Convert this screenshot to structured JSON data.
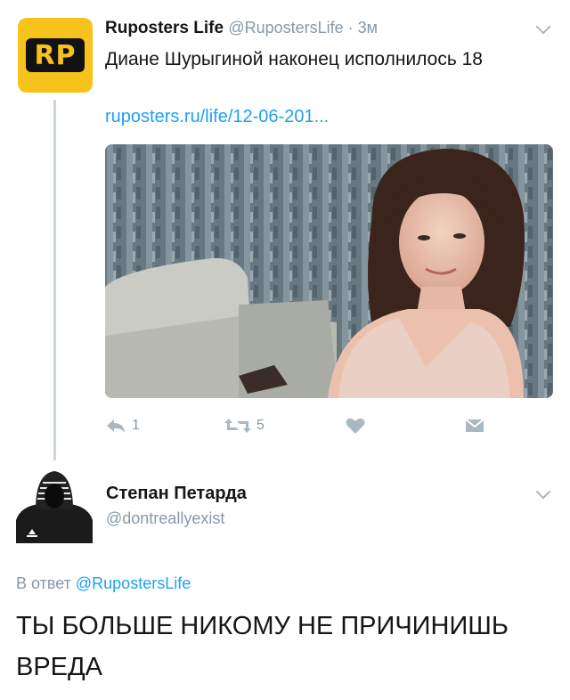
{
  "tweet1": {
    "author_name": "Ruposters Life",
    "author_handle": "@RupostersLife",
    "separator": " · ",
    "time": "3м",
    "avatar_text": "RP",
    "text": "Диане Шурыгиной наконец исполнилось 18",
    "link": "ruposters.ru/life/12-06-201...",
    "reply_count": "1",
    "retweet_count": "5",
    "colors": {
      "avatar_bg": "#f7c21b",
      "link": "#1da1f2",
      "muted": "#8899a6"
    }
  },
  "tweet2": {
    "author_name": "Степан Петарда",
    "author_handle": "@dontreallyexist",
    "reply_prefix": "В ответ ",
    "reply_mention": "@RupostersLife",
    "text": "ТЫ БОЛЬШЕ НИКОМУ НЕ ПРИЧИНИШЬ ВРЕДА"
  },
  "icons": [
    "reply-icon",
    "retweet-icon",
    "heart-icon",
    "message-icon",
    "chevron-down-icon"
  ]
}
